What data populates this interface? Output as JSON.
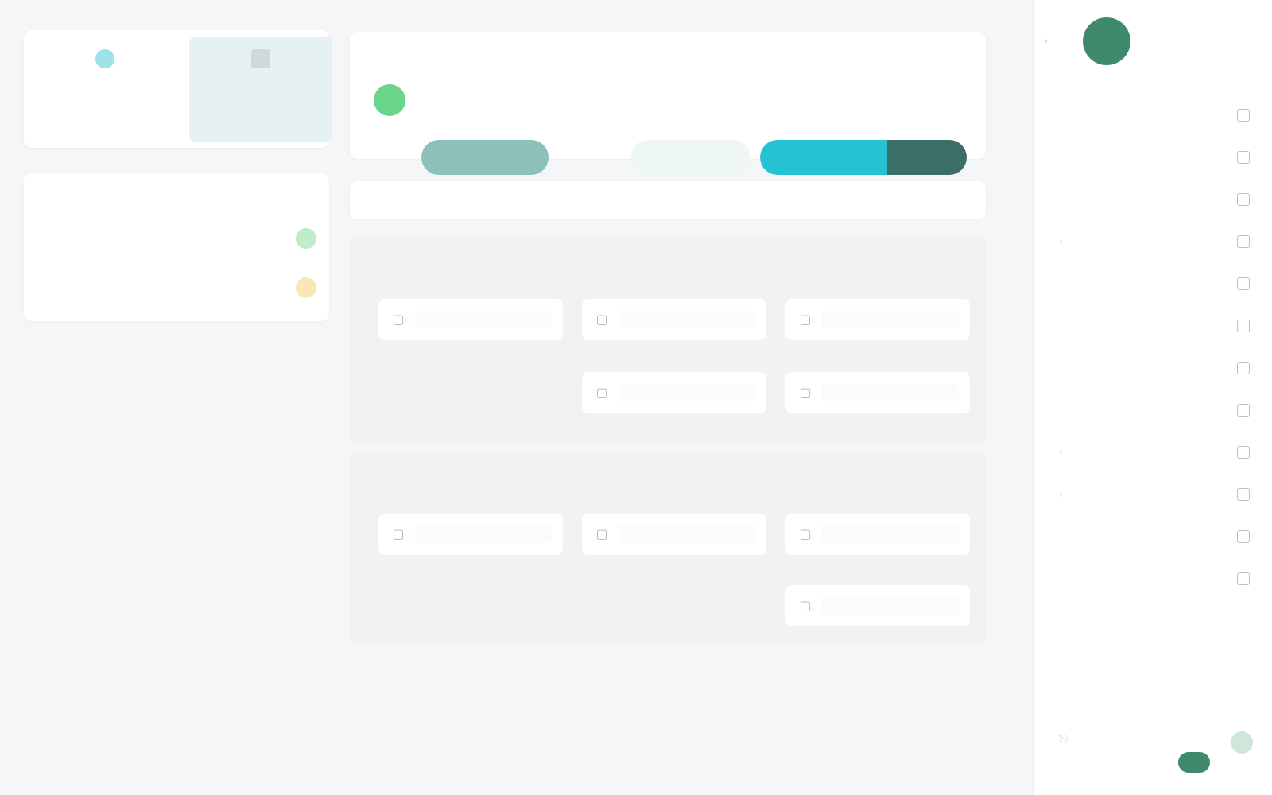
{
  "sidebar": {
    "logo_text": "",
    "nav": [
      {
        "label": "",
        "has_caret": false
      },
      {
        "label": "",
        "has_caret": false
      },
      {
        "label": "",
        "has_caret": false
      },
      {
        "label": "",
        "has_caret": true
      },
      {
        "label": "",
        "has_caret": false
      },
      {
        "label": "",
        "has_caret": false
      },
      {
        "label": "",
        "has_caret": false
      },
      {
        "label": "",
        "has_caret": false
      },
      {
        "label": "",
        "has_caret": true
      },
      {
        "label": "",
        "has_caret": true
      },
      {
        "label": "",
        "has_caret": false
      },
      {
        "label": "",
        "has_caret": false
      }
    ],
    "user": {
      "name": "",
      "role": ""
    }
  },
  "header": {
    "title": "",
    "subtitle": "",
    "live_label": "",
    "actions": {
      "primary_dark": "",
      "primary_cyan": "",
      "ghost": "",
      "danger": "",
      "secondary": ""
    }
  },
  "section_bar": {
    "label": ""
  },
  "groups": [
    {
      "title": "",
      "code": ""
    },
    {
      "title": "",
      "code": ""
    },
    {
      "title": "",
      "code": ""
    }
  ],
  "stats": [
    {
      "value": "",
      "label": ""
    },
    {
      "value": "",
      "label": ""
    }
  ],
  "list": {
    "title": "",
    "rows": [
      {
        "name": "",
        "meta": "",
        "date": ""
      },
      {
        "name": "",
        "meta": "",
        "date": ""
      }
    ]
  },
  "colors": {
    "brand": "#3f8a6a",
    "accent_cyan": "#26c2d4",
    "dark_teal": "#3b6e66",
    "danger": "#e87d89",
    "success": "#6ad48a",
    "warning": "#fbe7b6"
  }
}
